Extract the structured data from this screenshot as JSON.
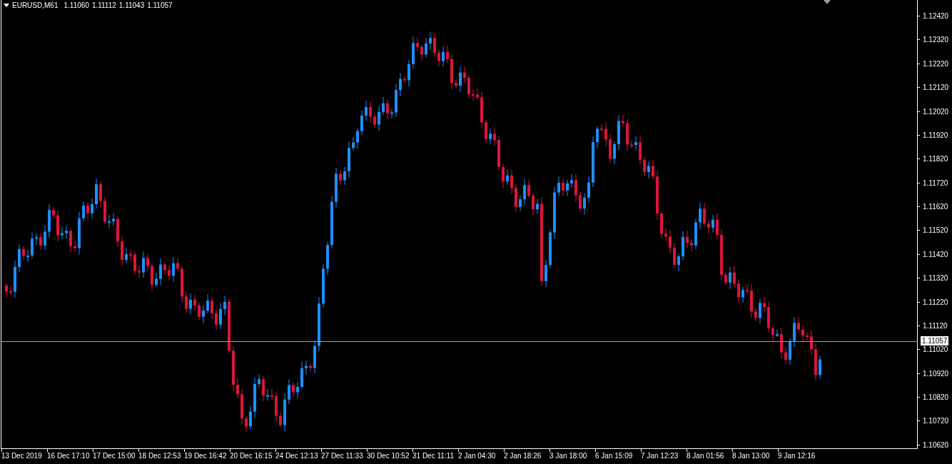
{
  "header": {
    "symbol": "EURUSD,M61",
    "ohlc": [
      "1.11060",
      "1.11112",
      "1.11043",
      "1.11057"
    ]
  },
  "price_axis": {
    "labels": [
      "1.12420",
      "1.12320",
      "1.12220",
      "1.12120",
      "1.12020",
      "1.11920",
      "1.11820",
      "1.11720",
      "1.11620",
      "1.11520",
      "1.11420",
      "1.11320",
      "1.11220",
      "1.11120",
      "1.11020",
      "1.10920",
      "1.10820",
      "1.10720",
      "1.10620"
    ]
  },
  "current_price": "1.11057",
  "time_axis": {
    "labels": [
      "13 Dec 2019",
      "16 Dec 17:10",
      "17 Dec 15:00",
      "18 Dec 12:53",
      "19 Dec 16:42",
      "20 Dec 16:15",
      "24 Dec 12:13",
      "27 Dec 11:33",
      "30 Dec 10:52",
      "31 Dec 11:11",
      "2 Jan 04:30",
      "2 Jan 18:26",
      "3 Jan 18:00",
      "6 Jan 15:09",
      "7 Jan 12:23",
      "8 Jan 01:56",
      "8 Jan 13:00",
      "9 Jan 12:16"
    ]
  }
}
